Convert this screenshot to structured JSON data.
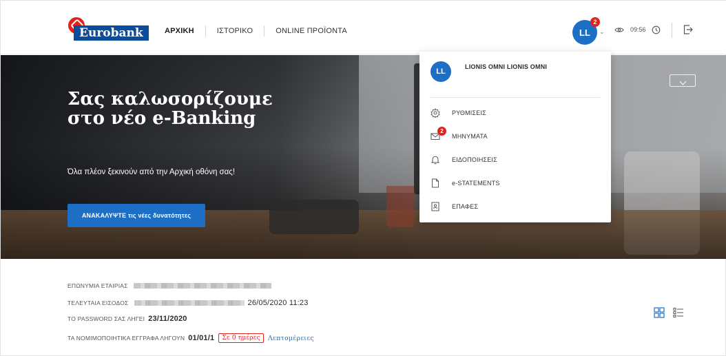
{
  "brand": {
    "name": "Eurobank",
    "primary": "#1d6fc6",
    "red": "#e2231a",
    "navy": "#0a4d9f"
  },
  "nav": {
    "items": [
      "ΑΡΧΙΚΗ",
      "ΙΣΤΟΡΙΚΟ",
      "ONLINE ΠΡΟΪΟΝΤΑ"
    ]
  },
  "header": {
    "avatar_initials": "LL",
    "notification_count": "2",
    "session_time": "09:56"
  },
  "hero": {
    "title": "Σας καλωσορίζουμε στο νέο e-Banking",
    "subtitle": "Όλα πλέον ξεκινούν από την Αρχική οθόνη σας!",
    "button": "ΑΝΑΚΑΛΥΨΤΕ τις νέες δυνατότητες"
  },
  "dropdown": {
    "avatar_initials": "LL",
    "user_name": "LIONIS OMNI LIONIS OMNI",
    "items": [
      {
        "label": "ΡΥΘΜΙΣΕΙΣ",
        "icon": "gear-icon"
      },
      {
        "label": "ΜΗΝΥΜΑΤΑ",
        "icon": "envelope-icon",
        "badge": "2"
      },
      {
        "label": "ΕΙΔΟΠΟΙΗΣΕΙΣ",
        "icon": "bell-icon"
      },
      {
        "label": "e-STATEMENTS",
        "icon": "document-icon"
      },
      {
        "label": "ΕΠΑΦΕΣ",
        "icon": "contacts-icon"
      }
    ]
  },
  "info": {
    "company_label": "ΕΠΩΝΥΜΙΑ ΕΤΑΙΡΙΑΣ",
    "last_login_label": "ΤΕΛΕΥΤΑΙΑ ΕΙΣΟΔΟΣ",
    "last_login_value": "26/05/2020 11:23",
    "password_label": "ΤΟ PASSWORD ΣΑΣ ΛΗΓΕΙ",
    "password_value": "23/11/2020",
    "docs_label": "ΤΑ ΝΟΜΙΜΟΠΟΙΗΤΙΚΑ ΕΓΓΡΑΦΑ ΛΗΓΟΥΝ",
    "docs_value": "01/01/1",
    "docs_badge": "Σε 0 ημέρες",
    "docs_link": "Λεπτομέρειες"
  }
}
